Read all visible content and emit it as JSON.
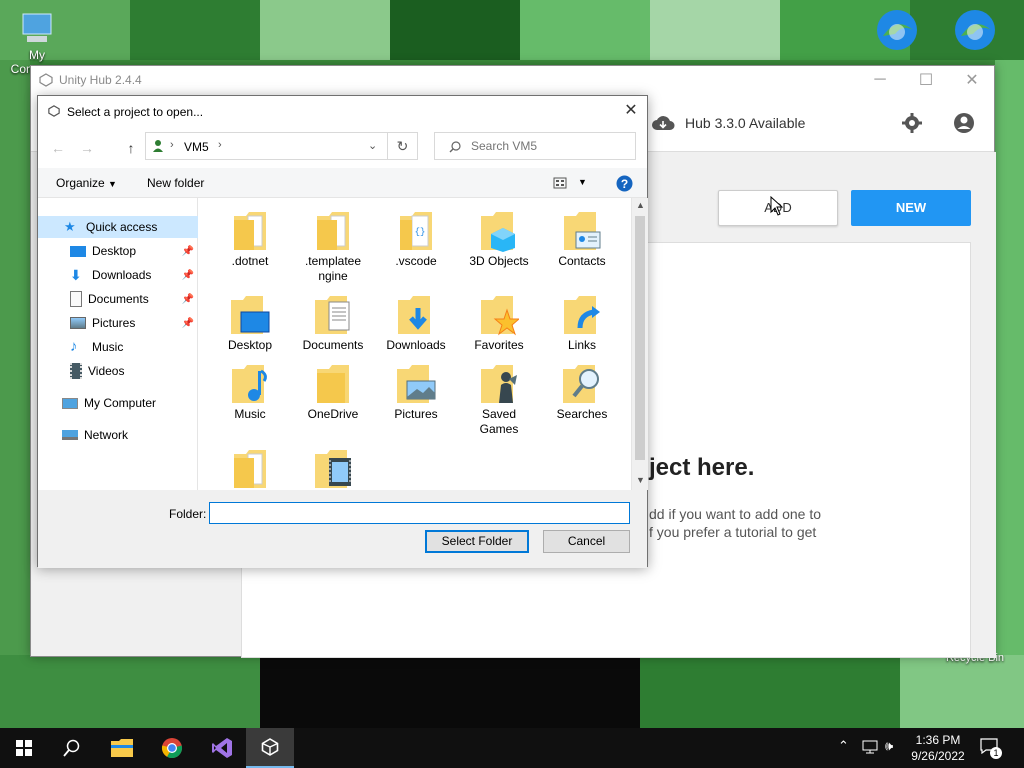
{
  "desktop": {
    "icons": [
      {
        "name": "my-computer-desktop-icon",
        "label": "My Computer"
      },
      {
        "name": "edge-desktop-icon-1",
        "label": ""
      },
      {
        "name": "edge-desktop-icon-2",
        "label": ""
      },
      {
        "name": "recycle-bin-desktop-icon",
        "label": "Recycle Bin"
      }
    ]
  },
  "hub": {
    "title": "Unity Hub 2.4.4",
    "update_text": "Hub 3.3.0 Available",
    "add_label": "ADD",
    "new_label": "NEW",
    "empty_title": "ject here.",
    "empty_desc_line1": "dd if you want to add one to",
    "empty_desc_line2": "f you prefer a tutorial to get"
  },
  "dialog": {
    "title": "Select a project to open...",
    "address": "VM5",
    "search_placeholder": "Search VM5",
    "organize_label": "Organize",
    "new_folder_label": "New folder",
    "sidebar": [
      {
        "label": "Quick access",
        "pinned": false,
        "selected": true
      },
      {
        "label": "Desktop",
        "pinned": true
      },
      {
        "label": "Downloads",
        "pinned": true
      },
      {
        "label": "Documents",
        "pinned": true
      },
      {
        "label": "Pictures",
        "pinned": true
      },
      {
        "label": "Music",
        "pinned": false
      },
      {
        "label": "Videos",
        "pinned": false
      },
      {
        "label": "My Computer",
        "pinned": false
      },
      {
        "label": "Network",
        "pinned": false
      }
    ],
    "files": [
      {
        "line1": ".dotnet",
        "line2": ""
      },
      {
        "line1": ".templatee",
        "line2": "ngine"
      },
      {
        "line1": ".vscode",
        "line2": ""
      },
      {
        "line1": "3D Objects",
        "line2": ""
      },
      {
        "line1": "Contacts",
        "line2": ""
      },
      {
        "line1": "Desktop",
        "line2": ""
      },
      {
        "line1": "Documents",
        "line2": ""
      },
      {
        "line1": "Downloads",
        "line2": ""
      },
      {
        "line1": "Favorites",
        "line2": ""
      },
      {
        "line1": "Links",
        "line2": ""
      },
      {
        "line1": "Music",
        "line2": ""
      },
      {
        "line1": "OneDrive",
        "line2": ""
      },
      {
        "line1": "Pictures",
        "line2": ""
      },
      {
        "line1": "Saved",
        "line2": "Games"
      },
      {
        "line1": "Searches",
        "line2": ""
      },
      {
        "line1": "",
        "line2": ""
      },
      {
        "line1": "",
        "line2": ""
      }
    ],
    "folder_label": "Folder:",
    "folder_value": "",
    "select_folder_label": "Select Folder",
    "cancel_label": "Cancel"
  },
  "taskbar": {
    "time": "1:36 PM",
    "date": "9/26/2022",
    "notification_count": "1"
  },
  "colors": {
    "accent": "#0078d7",
    "hub_blue": "#2196f3",
    "folder_yellow": "#f8d775"
  }
}
